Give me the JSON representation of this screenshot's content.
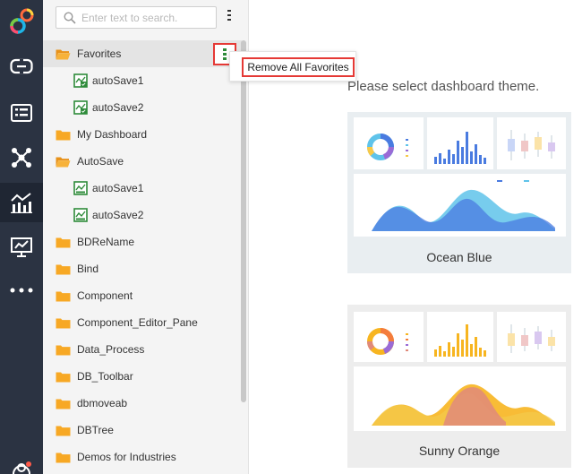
{
  "search": {
    "placeholder": "Enter text to search."
  },
  "tree": {
    "items": [
      {
        "label": "Favorites",
        "type": "folder-open",
        "level": 0,
        "selected": true
      },
      {
        "label": "autoSave1",
        "type": "dashboard-fav",
        "level": 1
      },
      {
        "label": "autoSave2",
        "type": "dashboard-fav",
        "level": 1
      },
      {
        "label": "My Dashboard",
        "type": "folder",
        "level": 0
      },
      {
        "label": "AutoSave",
        "type": "folder-open",
        "level": 0
      },
      {
        "label": "autoSave1",
        "type": "dashboard",
        "level": 1
      },
      {
        "label": "autoSave2",
        "type": "dashboard",
        "level": 1
      },
      {
        "label": "BDReName",
        "type": "folder",
        "level": 0
      },
      {
        "label": "Bind",
        "type": "folder",
        "level": 0
      },
      {
        "label": "Component",
        "type": "folder",
        "level": 0
      },
      {
        "label": "Component_Editor_Pane",
        "type": "folder",
        "level": 0
      },
      {
        "label": "Data_Process",
        "type": "folder",
        "level": 0
      },
      {
        "label": "DB_Toolbar",
        "type": "folder",
        "level": 0
      },
      {
        "label": "dbmoveab",
        "type": "folder",
        "level": 0
      },
      {
        "label": "DBTree",
        "type": "folder",
        "level": 0
      },
      {
        "label": "Demos for Industries",
        "type": "folder",
        "level": 0
      }
    ]
  },
  "popup": {
    "item": "Remove All Favorites"
  },
  "main": {
    "prompt": "Please select dashboard theme.",
    "themes": [
      {
        "name": "Ocean Blue",
        "accent": "#4a7be0",
        "secondary": "#5fc3ea"
      },
      {
        "name": "Sunny Orange",
        "accent": "#f7b520",
        "secondary": "#e08a7a"
      }
    ]
  },
  "colors": {
    "rail": "#2b3342",
    "folder": "#f7a824",
    "highlight": "#e53935",
    "dashboard_icon": "#2e8b3a"
  }
}
